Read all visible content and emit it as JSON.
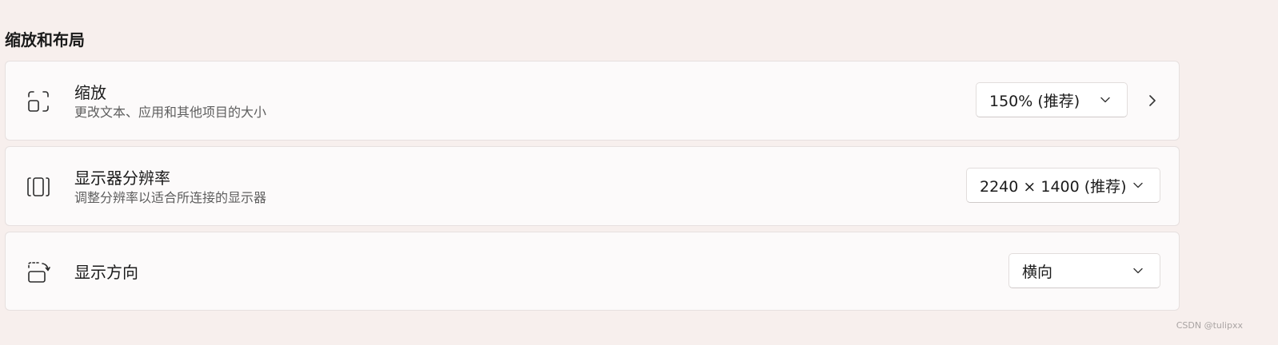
{
  "section": {
    "title": "缩放和布局"
  },
  "settings": [
    {
      "id": "scale",
      "icon": "scale-icon",
      "title": "缩放",
      "subtitle": "更改文本、应用和其他项目的大小",
      "value": "150% (推荐)",
      "has_nav_arrow": true
    },
    {
      "id": "resolution",
      "icon": "resolution-icon",
      "title": "显示器分辨率",
      "subtitle": "调整分辨率以适合所连接的显示器",
      "value": "2240 × 1400 (推荐)",
      "has_nav_arrow": false
    },
    {
      "id": "orientation",
      "icon": "orientation-icon",
      "title": "显示方向",
      "subtitle": "",
      "value": "横向",
      "has_nav_arrow": false
    }
  ],
  "watermark": "CSDN @tulipxx",
  "colors": {
    "background": "#f7efed",
    "card": "#fcfafa",
    "card_border": "#e6e0df",
    "text_primary": "#1b1b1b",
    "text_secondary": "#5e5e5e"
  }
}
